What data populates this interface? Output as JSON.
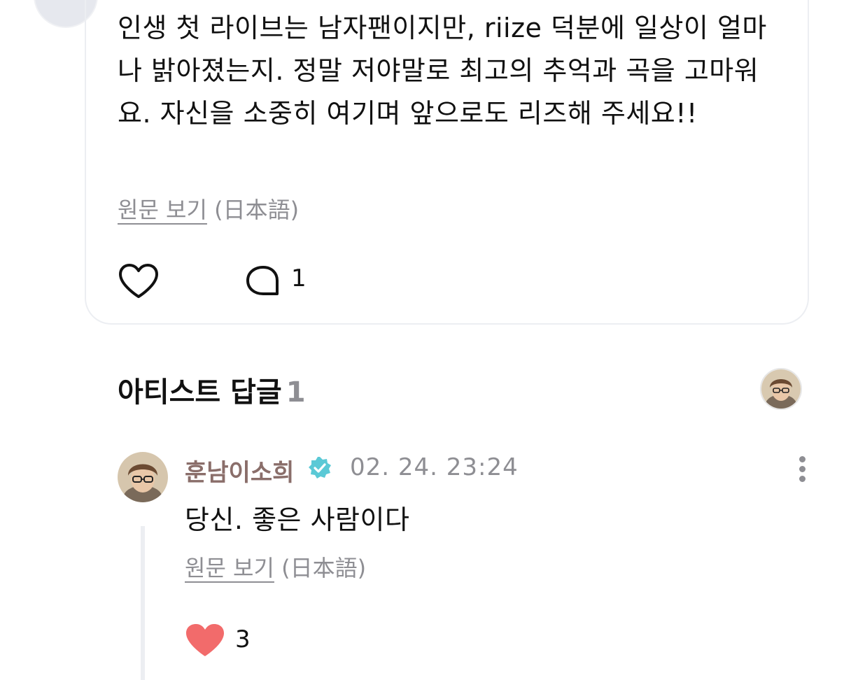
{
  "post": {
    "body": "인생 첫 라이브는 남자팬이지만, riize 덕분에 일상이 얼마나 밝아졌는지. 정말 저야말로 최고의 추억과 곡을 고마워요. 자신을 소중히 여기며 앞으로도 리즈해 주세요!!",
    "view_original": "원문 보기",
    "original_language": "(日本語)",
    "reply_count": "1"
  },
  "artist_replies": {
    "title": "아티스트 답글",
    "count": "1"
  },
  "reply": {
    "author": "훈남이소희",
    "timestamp": "02. 24. 23:24",
    "text": "당신. 좋은 사람이다",
    "view_original": "원문 보기",
    "original_language": "(日本語)",
    "like_count": "3"
  },
  "icons": {
    "like": "heart-outline-icon",
    "comment": "comment-bubble-icon",
    "verified": "verified-badge-icon",
    "more": "more-vertical-icon",
    "liked": "heart-filled-icon"
  },
  "colors": {
    "liked_heart": "#f26b6b",
    "verified_badge": "#5bc9d6",
    "author_name": "#8a6e6a",
    "secondary_text": "#8e8e93"
  }
}
